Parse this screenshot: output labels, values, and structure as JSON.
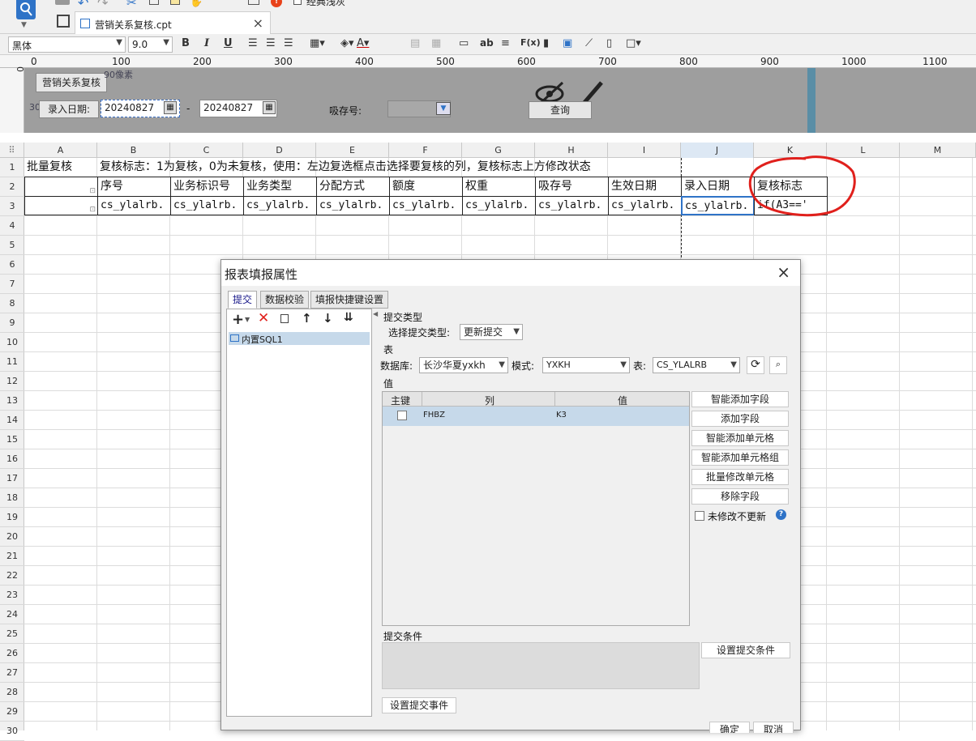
{
  "app": {
    "tab_title": "营销关系复核.cpt",
    "toolbar_partial_label": "经典浅灰",
    "notification_count": "!"
  },
  "format_bar": {
    "font_family_value": "黑体",
    "font_size_value": "9.0",
    "bold": "B",
    "italic": "I",
    "underline": "U",
    "insert_text_label": "ab",
    "formula_label": "F(x)"
  },
  "ruler": {
    "ticks": [
      "0",
      "100",
      "200",
      "300",
      "400",
      "500",
      "600",
      "700",
      "800",
      "900",
      "1000",
      "1100"
    ],
    "vertical_zero": "0"
  },
  "parameter_pane": {
    "title_button": "营销关系复核",
    "pixel_note_top": "90像素",
    "pixel_note_left": "30像素",
    "entry_date_label": "录入日期:",
    "date_from_value": "20240827",
    "dash": "-",
    "date_to_value": "20240827",
    "deposit_label": "吸存号:",
    "query_button": "查询"
  },
  "sheet": {
    "columns": [
      "A",
      "B",
      "C",
      "D",
      "E",
      "F",
      "G",
      "H",
      "I",
      "J",
      "K",
      "L",
      "M"
    ],
    "rows": [
      "1",
      "2",
      "3",
      "4",
      "5",
      "6",
      "7",
      "8",
      "9",
      "10",
      "11",
      "12",
      "13",
      "14",
      "15",
      "16",
      "17",
      "18",
      "19",
      "20",
      "21",
      "22",
      "23",
      "24",
      "25",
      "26",
      "27",
      "28",
      "29",
      "30"
    ],
    "row1": {
      "a": "批量复核",
      "b": "复核标志：1为复核，0为未复核，使用：左边复选框点击选择要复核的列，复核标志上方修改状态"
    },
    "row2": [
      "序号",
      "业务标识号",
      "业务类型",
      "分配方式",
      "额度",
      "权重",
      "吸存号",
      "生效日期",
      "录入日期",
      "复核标志"
    ],
    "row3": [
      "cs_ylalrb.",
      "cs_ylalrb.",
      "cs_ylalrb.",
      "cs_ylalrb.",
      "cs_ylalrb.",
      "cs_ylalrb.",
      "cs_ylalrb.",
      "cs_ylalrb.",
      "cs_ylalrb.",
      "if(A3=='"
    ]
  },
  "dialog": {
    "title": "报表填报属性",
    "tabs": [
      "提交",
      "数据校验",
      "填报快捷键设置"
    ],
    "tree_item": "内置SQL1",
    "submit_type_section": "提交类型",
    "submit_type_label": "选择提交类型:",
    "submit_type_value": "更新提交",
    "table_section": "表",
    "database_label": "数据库:",
    "database_value": "长沙华夏yxkh",
    "schema_label": "模式:",
    "schema_value": "YXKH",
    "table_label": "表:",
    "table_value": "CS_YLALRB",
    "value_section": "值",
    "grid_headers": [
      "主键",
      "列",
      "值"
    ],
    "grid_rows": [
      {
        "column": "FHBZ",
        "value": "K3"
      }
    ],
    "buttons": [
      "智能添加字段",
      "添加字段",
      "智能添加单元格",
      "智能添加单元格组",
      "批量修改单元格",
      "移除字段"
    ],
    "no_update_unchanged_label": "未修改不更新",
    "submit_condition_section": "提交条件",
    "set_condition_button": "设置提交条件",
    "set_event_button": "设置提交事件",
    "ok_button": "确定",
    "cancel_button": "取消"
  },
  "colors": {
    "accent_blue": "#2f73c7",
    "param_bg": "#9e9e9e",
    "annotation_red": "#e0201c",
    "selected_row": "#c6d9ea"
  }
}
